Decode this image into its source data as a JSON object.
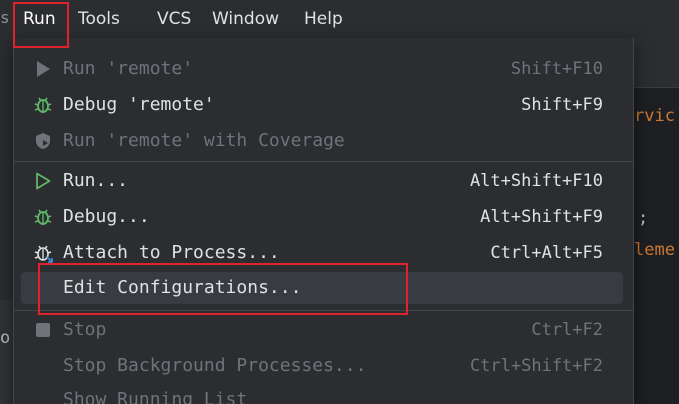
{
  "menubar": {
    "items": [
      {
        "label": "Run"
      },
      {
        "label": "Tools"
      },
      {
        "label": "VCS"
      },
      {
        "label": "Window"
      },
      {
        "label": "Help"
      }
    ]
  },
  "editor": {
    "fragments": [
      "rvic",
      ";",
      "leme",
      "o"
    ]
  },
  "menu": {
    "items": [
      {
        "label": "Run 'remote'",
        "shortcut": "Shift+F10"
      },
      {
        "label": "Debug 'remote'",
        "shortcut": "Shift+F9"
      },
      {
        "label": "Run 'remote' with Coverage",
        "shortcut": ""
      },
      {
        "label": "Run...",
        "shortcut": "Alt+Shift+F10"
      },
      {
        "label": "Debug...",
        "shortcut": "Alt+Shift+F9"
      },
      {
        "label": "Attach to Process...",
        "shortcut": "Ctrl+Alt+F5"
      },
      {
        "label": "Edit Configurations...",
        "shortcut": ""
      },
      {
        "label": "Stop",
        "shortcut": "Ctrl+F2"
      },
      {
        "label": "Stop Background Processes...",
        "shortcut": "Ctrl+Shift+F2"
      },
      {
        "label": "Show Running List",
        "shortcut": ""
      }
    ]
  },
  "colors": {
    "accent_annotation": "#e0222e",
    "run_green": "#5fb865",
    "disabled_gray": "#6f737a"
  },
  "icons": [
    "run-icon",
    "debug-icon",
    "coverage-icon",
    "run-icon",
    "debug-icon",
    "attach-icon",
    "stop-icon"
  ]
}
